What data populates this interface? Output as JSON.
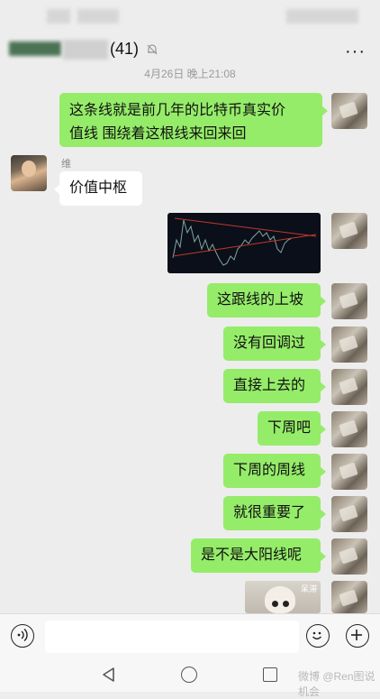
{
  "header": {
    "count": "(41)",
    "more": "···"
  },
  "timestamp": "4月26日 晚上21:08",
  "sender": {
    "name": "维"
  },
  "messages": [
    "这条线就是前几年的比特币真实价值线 围绕着这根线来回来回",
    "价值中枢",
    "这跟线的上坡",
    "没有回调过",
    "直接上去的",
    "下周吧",
    "下周的周线",
    "就很重要了",
    "是不是大阳线呢"
  ],
  "message_lines": {
    "first_line_1": "这条线就是前几年的比特币真实价",
    "first_line_2": "值线 围绕着这根线来回来回"
  },
  "sticker": {
    "label": "呆滞"
  },
  "watermark": "微博 @Ren图说机会",
  "colors": {
    "me_bubble": "#95ec69",
    "other_bubble": "#ffffff",
    "background": "#ededed"
  }
}
